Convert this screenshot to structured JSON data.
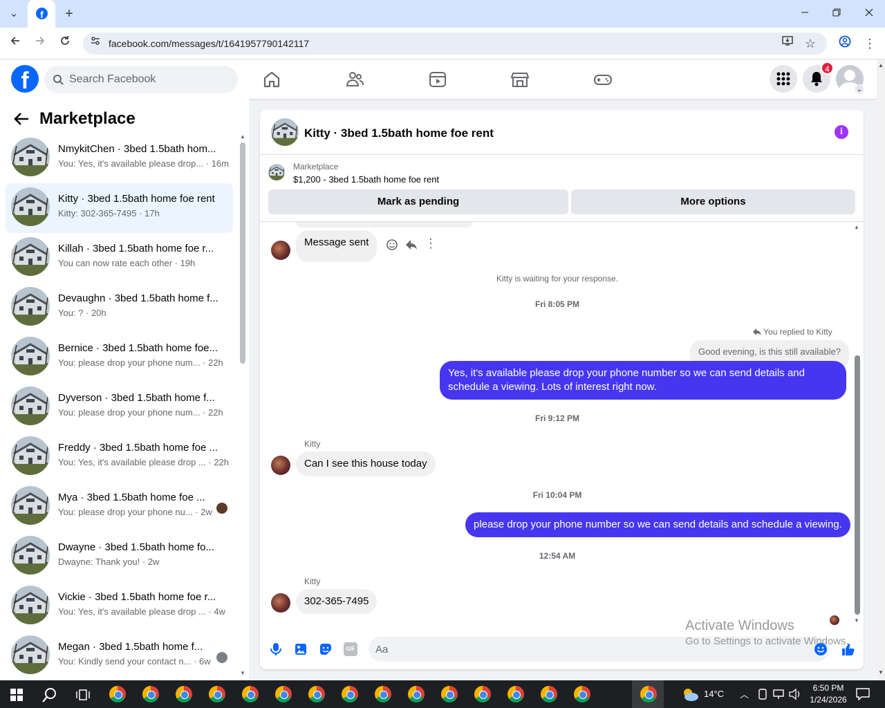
{
  "browser": {
    "url": "facebook.com/messages/t/1641957790142117",
    "new_tab_glyph": "+"
  },
  "header": {
    "search_placeholder": "Search Facebook",
    "notification_count": "4"
  },
  "marketplace": {
    "title": "Marketplace",
    "conversations": [
      {
        "name": "NmykitChen · 3bed 1.5bath hom...",
        "snippet": "You: Yes, it's available please drop... · 16m"
      },
      {
        "name": "Kitty · 3bed 1.5bath home foe rent",
        "snippet": "Kitty: 302-365-7495 · 17h"
      },
      {
        "name": "Killah · 3bed 1.5bath home foe r...",
        "snippet": "You can now rate each other · 19h"
      },
      {
        "name": "Devaughn · 3bed 1.5bath home f...",
        "snippet": "You: ? · 20h"
      },
      {
        "name": "Bernice · 3bed 1.5bath home foe...",
        "snippet": "You: please drop your phone num... · 22h"
      },
      {
        "name": "Dyverson · 3bed 1.5bath home f...",
        "snippet": "You: please drop your phone num... · 22h"
      },
      {
        "name": "Freddy · 3bed 1.5bath home foe ...",
        "snippet": "You: Yes, it's available please drop ... · 22h"
      },
      {
        "name": "Mya · 3bed 1.5bath home foe ...",
        "snippet": "You: please drop your phone nu... · 2w"
      },
      {
        "name": "Dwayne · 3bed 1.5bath home fo...",
        "snippet": "Dwayne: Thank you! · 2w"
      },
      {
        "name": "Vickie · 3bed 1.5bath home foe r...",
        "snippet": "You: Yes, it's available please drop ... · 4w"
      },
      {
        "name": "Megan · 3bed 1.5bath home f...",
        "snippet": "You: Kindly send your contact n... · 6w"
      }
    ]
  },
  "chat": {
    "title": "Kitty · 3bed 1.5bath home foe rent",
    "listing_label": "Marketplace",
    "listing_price": "$1,200 - 3bed 1.5bath home foe rent",
    "mark_pending": "Mark as pending",
    "more_options": "More options",
    "info_glyph": "i",
    "message_sent": "Message sent",
    "waiting": "Kitty is waiting for your response.",
    "ts1": "Fri 8:05 PM",
    "replied_to": "You replied to Kitty",
    "quoted": "Good evening, is this still available?",
    "out1": "Yes, it's available please drop your phone number so we can send details and schedule a viewing. Lots of interest right now.",
    "ts2": "Fri 9:12 PM",
    "sender1": "Kitty",
    "in1": "Can I see this house today",
    "ts3": "Fri 10:04 PM",
    "out2": "please drop your phone number so we can send details and schedule a viewing.",
    "ts4": "12:54 AM",
    "sender2": "Kitty",
    "in2": "302-365-7495",
    "composer_placeholder": "Aa"
  },
  "watermark": {
    "line1": "Activate Windows",
    "line2": "Go to Settings to activate Windows."
  },
  "taskbar": {
    "temperature": "14°C",
    "time": "6:50 PM",
    "date": "1/24/2026"
  },
  "colors": {
    "fb_blue": "#0866ff",
    "outgoing_bubble": "#4736f0",
    "badge_red": "#e41e3f",
    "info_purple": "#a033ff"
  }
}
